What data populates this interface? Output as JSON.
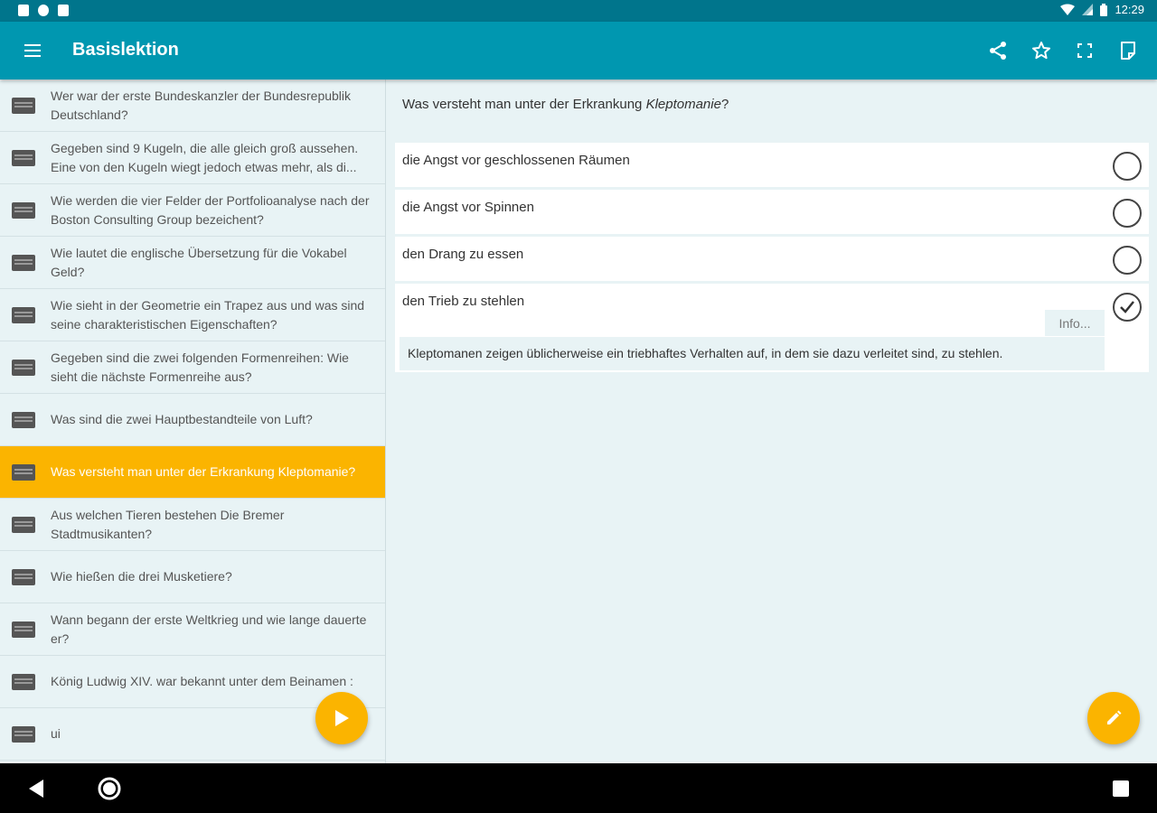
{
  "status_bar": {
    "time": "12:29"
  },
  "app_bar": {
    "title": "Basislektion",
    "icons": [
      "menu-icon",
      "share-icon",
      "star-icon",
      "fullscreen-icon",
      "note-icon"
    ]
  },
  "sidebar": {
    "items": [
      {
        "text": "Wer war der erste Bundeskanzler der Bundesrepublik Deutschland?"
      },
      {
        "text": "Gegeben sind 9 Kugeln, die alle gleich groß aussehen. Eine von den Kugeln wiegt jedoch etwas mehr, als di..."
      },
      {
        "text": "Wie werden die vier Felder der Portfolioanalyse nach der Boston Consulting Group bezeichent?"
      },
      {
        "text": "Wie lautet die englische Übersetzung für die Vokabel Geld?"
      },
      {
        "text": "Wie sieht in der Geometrie ein Trapez aus und was sind seine charakteristischen Eigenschaften?"
      },
      {
        "text": "Gegeben sind die zwei folgenden Formenreihen: Wie sieht die nächste Formenreihe aus?"
      },
      {
        "text": "Was sind die zwei Hauptbestandteile von Luft?"
      },
      {
        "text": "Was versteht man unter der Erkrankung Kleptomanie?",
        "active": true
      },
      {
        "text": "Aus welchen Tieren bestehen Die Bremer Stadtmusikanten?"
      },
      {
        "text": "Wie hießen die drei Musketiere?"
      },
      {
        "text": "Wann begann der erste Weltkrieg und wie lange dauerte er?"
      },
      {
        "text": "König Ludwig XIV. war bekannt unter dem Beinamen :"
      },
      {
        "text": "ui"
      }
    ]
  },
  "question": {
    "prefix": "Was versteht man unter der Erkrankung ",
    "emphasis": "Kleptomanie",
    "suffix": "?"
  },
  "answers": [
    {
      "text": "die Angst vor geschlossenen Räumen",
      "checked": false
    },
    {
      "text": "die Angst vor Spinnen",
      "checked": false
    },
    {
      "text": "den Drang zu essen",
      "checked": false
    },
    {
      "text": "den Trieb zu stehlen",
      "checked": true
    }
  ],
  "info": {
    "button_label": "Info...",
    "text": "Kleptomanen zeigen üblicherweise ein triebhaftes Verhalten auf, in dem sie dazu verleitet sind, zu stehlen."
  },
  "colors": {
    "app_bar": "#0097b0",
    "status_bar": "#00758c",
    "accent": "#fbb400",
    "background": "#e8f3f5"
  }
}
